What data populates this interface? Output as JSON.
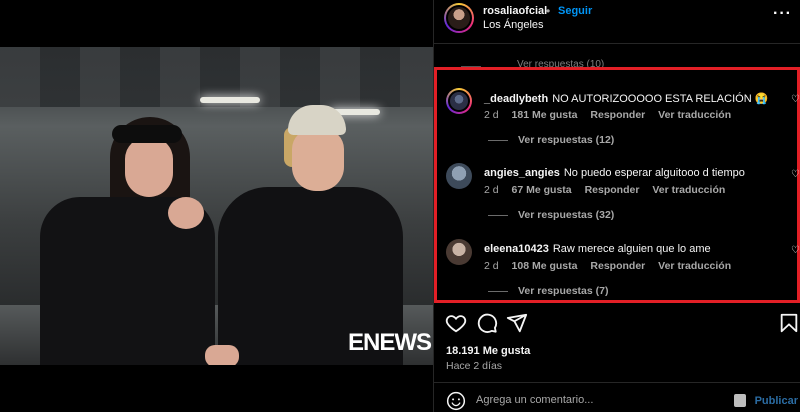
{
  "photo": {
    "watermark": "ENEWS"
  },
  "post": {
    "author": "rosaliaofcial",
    "separator": "•",
    "follow_label": "Seguir",
    "location": "Los Ángeles",
    "more_icon": "more-horizontal-icon"
  },
  "faded_replies": "Ver respuestas (10)",
  "comments": [
    {
      "user": "_deadlybeth",
      "text": "NO AUTORIZOOOOO ESTA RELACIÓN 😭",
      "age": "2 d",
      "likes": "181 Me gusta",
      "reply": "Responder",
      "translate": "Ver traducción",
      "replies": "Ver respuestas (12)"
    },
    {
      "user": "angies_angies",
      "text": "No puedo esperar alguitooo d tiempo",
      "age": "2 d",
      "likes": "67 Me gusta",
      "reply": "Responder",
      "translate": "Ver traducción",
      "replies": "Ver respuestas (32)"
    },
    {
      "user": "eleena10423",
      "text": "Raw merece alguien que lo ame",
      "age": "2 d",
      "likes": "108 Me gusta",
      "reply": "Responder",
      "translate": "Ver traducción",
      "replies": "Ver respuestas (7)"
    }
  ],
  "actions": {
    "icons": [
      "heart-icon",
      "comment-icon",
      "share-icon",
      "bookmark-icon"
    ]
  },
  "likes_count": "18.191 Me gusta",
  "time_ago": "Hace 2 días",
  "comment_bar": {
    "placeholder": "Agrega un comentario...",
    "publish_label": "Publicar"
  },
  "colors": {
    "highlight": "#e21f26",
    "link": "#0095f6",
    "muted": "#a8a8a8"
  }
}
